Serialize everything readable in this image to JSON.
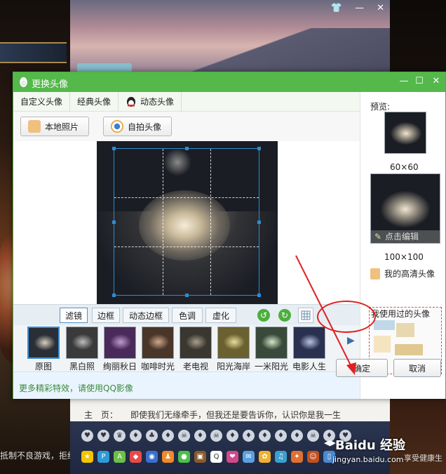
{
  "dialog": {
    "title": "更换头像",
    "tabs": [
      {
        "label": "自定义头像"
      },
      {
        "label": "经典头像"
      },
      {
        "label": "动态头像"
      }
    ],
    "tool_buttons": {
      "local_photo": "本地照片",
      "selfie": "自拍头像"
    },
    "filter_tabs": [
      {
        "label": "滤镜",
        "active": true
      },
      {
        "label": "边框"
      },
      {
        "label": "动态边框"
      },
      {
        "label": "色调"
      },
      {
        "label": "虚化"
      }
    ],
    "filters": [
      {
        "label": "原图",
        "color": "#d8cfbf"
      },
      {
        "label": "黑白照",
        "color": "#bdbdbd"
      },
      {
        "label": "绚丽秋日",
        "color": "#c29bd0"
      },
      {
        "label": "咖啡时光",
        "color": "#cfa88e"
      },
      {
        "label": "老电视",
        "color": "#a8a08a"
      },
      {
        "label": "阳光海岸",
        "color": "#e9dd9a"
      },
      {
        "label": "一米阳光",
        "color": "#d6e6c8"
      },
      {
        "label": "电影人生",
        "color": "#b9c6e0"
      }
    ],
    "more_effects": "更多精彩特效，请使用QQ影像",
    "ok_label": "确定",
    "cancel_label": "取消"
  },
  "side": {
    "preview_label": "预览:",
    "size_small": "60×60",
    "size_large": "100×100",
    "edit_hint": "点击编辑",
    "hd_avatar": "我的高清头像",
    "used_label": "我使用过的头像"
  },
  "background": {
    "profile_key": "主　页：",
    "profile_value": "即使我们无缘牵手，但我还是要告诉你，认识你是我一生",
    "left_text": "抵制不良游戏，拒绝",
    "right_text": "享受健康生",
    "watermark": "Baidu 经验",
    "watermark_url": "jingyan.baidu.com"
  },
  "colors": {
    "titlebar": "#54b84a",
    "accent_blue": "#2e8bd0",
    "annotation_red": "#e02020"
  }
}
